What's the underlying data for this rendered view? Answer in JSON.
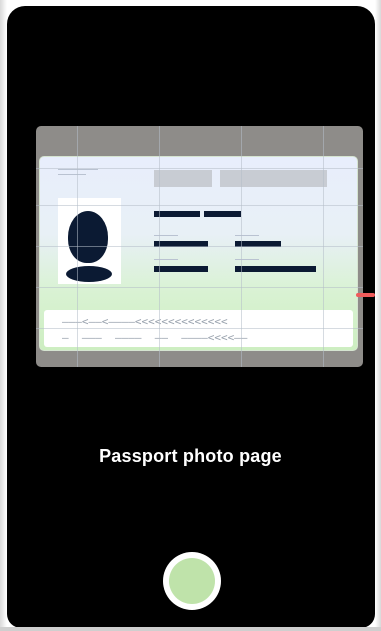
{
  "camera": {
    "instruction": "Passport photo page"
  },
  "colors": {
    "background": "#000000",
    "shutter_fill": "#bfe3aa",
    "scan_marker": "#ef5b5b",
    "frame": "#8e8c89"
  },
  "icons": {
    "document_photo": "person-silhouette-icon",
    "shutter": "shutter-button-icon"
  },
  "mrz": {
    "line1": "———<——<————<<<<<<<<<<<<<<",
    "line2": "—  ———  ————  ——  ————<<<<——"
  }
}
